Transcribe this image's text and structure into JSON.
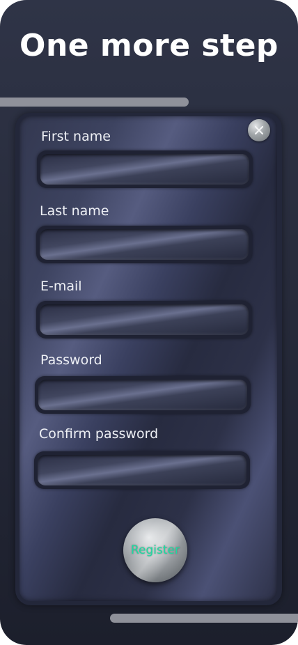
{
  "header": {
    "title": "One more step"
  },
  "form": {
    "fields": [
      {
        "label": "First name",
        "value": ""
      },
      {
        "label": "Last name",
        "value": ""
      },
      {
        "label": "E-mail",
        "value": ""
      },
      {
        "label": "Password",
        "value": ""
      },
      {
        "label": "Confirm password",
        "value": ""
      }
    ],
    "close_icon": "close-icon",
    "register_label": "Register"
  },
  "colors": {
    "background": "#2b3042",
    "register_text": "#1fd9a0",
    "decor_bar": "#8f919a"
  }
}
